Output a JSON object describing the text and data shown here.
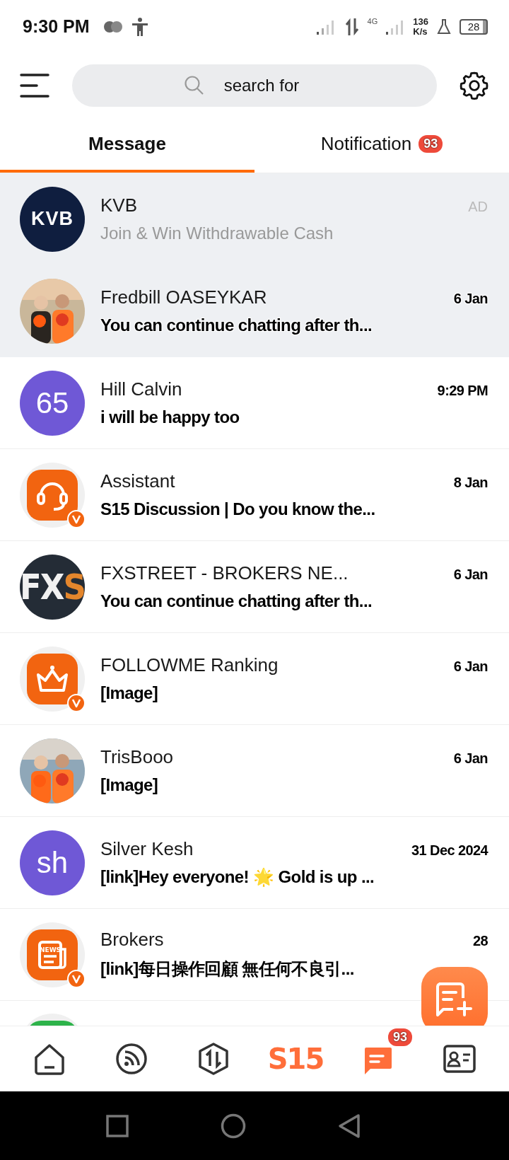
{
  "status_bar": {
    "time": "9:30 PM",
    "network": "4G",
    "speed_value": "136",
    "speed_unit": "K/s",
    "battery": "28"
  },
  "header": {
    "search": {
      "placeholder": "search for"
    }
  },
  "tabs": [
    {
      "label": "Message",
      "selected": true
    },
    {
      "label": "Notification",
      "selected": false,
      "badge": "93"
    }
  ],
  "conversations": [
    {
      "kind": "ad",
      "name": "KVB",
      "preview": "Join & Win Withdrawable Cash",
      "time": "AD",
      "pinned": true,
      "avatar": {
        "kind": "logo",
        "text": "KVB"
      }
    },
    {
      "kind": "chat",
      "name": "Fredbill OASEYKAR",
      "preview": "You can continue chatting after th...",
      "time": "6 Jan",
      "pinned": true
    },
    {
      "kind": "chat",
      "name": "Hill Calvin",
      "preview": "i will be happy too",
      "time": "9:29 PM",
      "pinned": false,
      "avatar": {
        "kind": "initials",
        "text": "65",
        "color": "#6f58d6"
      }
    },
    {
      "kind": "chat",
      "name": "Assistant",
      "preview": "S15 Discussion | Do you know the...",
      "time": "8 Jan",
      "pinned": false,
      "avatar": {
        "kind": "app",
        "verified": true
      }
    },
    {
      "kind": "chat",
      "name": "FXSTREET - BROKERS NE...",
      "preview": "You can continue chatting after th...",
      "time": "6 Jan",
      "pinned": false,
      "avatar": {
        "kind": "wordmark",
        "text": "FX",
        "accent": "S"
      }
    },
    {
      "kind": "chat",
      "name": "FOLLOWME Ranking",
      "preview": "[Image]",
      "time": "6 Jan",
      "pinned": false,
      "avatar": {
        "kind": "app",
        "verified": true
      }
    },
    {
      "kind": "chat",
      "name": "TrisBooo",
      "preview": "[Image]",
      "time": "6 Jan",
      "pinned": false
    },
    {
      "kind": "chat",
      "name": "Silver Kesh",
      "preview": "[link]Hey everyone! 🌟 Gold is up ...",
      "time": "31 Dec 2024",
      "pinned": false,
      "avatar": {
        "kind": "initials",
        "text": "sh",
        "color": "#6f58d6"
      }
    },
    {
      "kind": "chat",
      "name": "Brokers",
      "preview": "[link]每日操作回顧  無任何不良引...",
      "time": "28",
      "pinned": false,
      "avatar": {
        "kind": "app",
        "icon_text": "NEWS",
        "verified": true
      }
    },
    {
      "kind": "partial",
      "avatar": {
        "kind": "tile"
      }
    }
  ],
  "bottom_nav": [
    {
      "kind": "icon",
      "selected": false
    },
    {
      "kind": "icon",
      "selected": false
    },
    {
      "kind": "icon",
      "selected": false
    },
    {
      "kind": "wordmark",
      "text": "S15",
      "selected": false
    },
    {
      "kind": "icon",
      "selected": true,
      "badge": "93"
    },
    {
      "kind": "icon",
      "selected": false
    }
  ]
}
